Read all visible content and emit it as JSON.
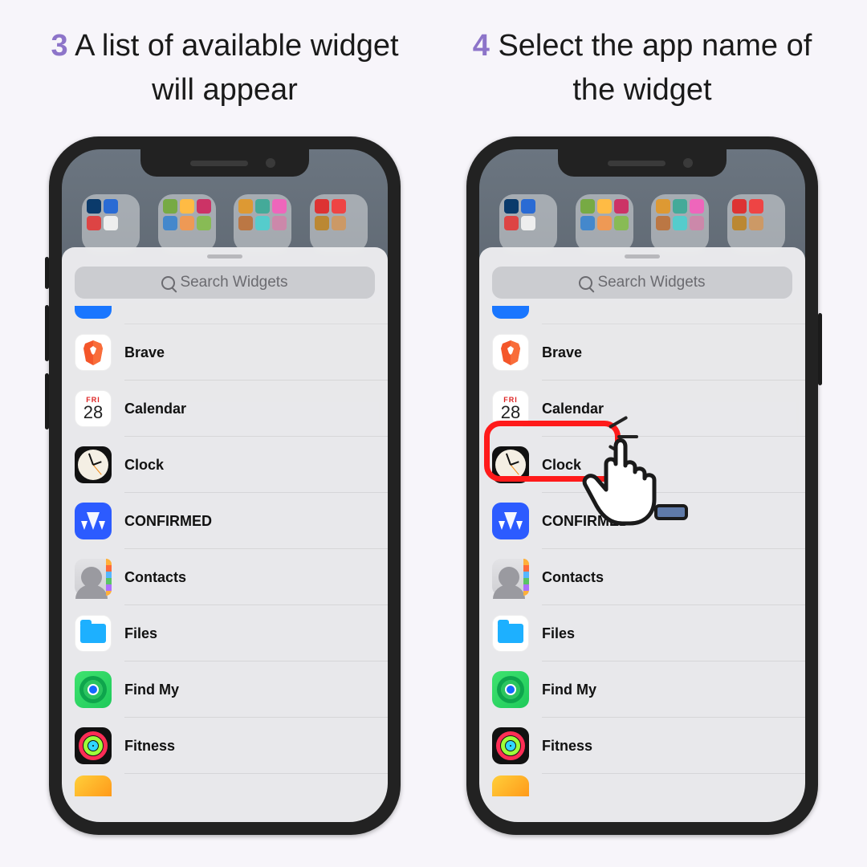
{
  "steps": [
    {
      "num": "3",
      "text": "A list of available widget will appear"
    },
    {
      "num": "4",
      "text": "Select the app name of the widget"
    }
  ],
  "search": {
    "placeholder": "Search Widgets"
  },
  "calendar": {
    "weekday": "FRI",
    "day": "28"
  },
  "widget_list": [
    {
      "key": "brave",
      "label": "Brave"
    },
    {
      "key": "calendar",
      "label": "Calendar"
    },
    {
      "key": "clock",
      "label": "Clock"
    },
    {
      "key": "confirmed",
      "label": "CONFIRMED"
    },
    {
      "key": "contacts",
      "label": "Contacts"
    },
    {
      "key": "files",
      "label": "Files"
    },
    {
      "key": "findmy",
      "label": "Find My"
    },
    {
      "key": "fitness",
      "label": "Fitness"
    }
  ],
  "highlight_target": "clock",
  "colors": {
    "step_number": "#8d74c9",
    "highlight": "#ff1a1a"
  }
}
